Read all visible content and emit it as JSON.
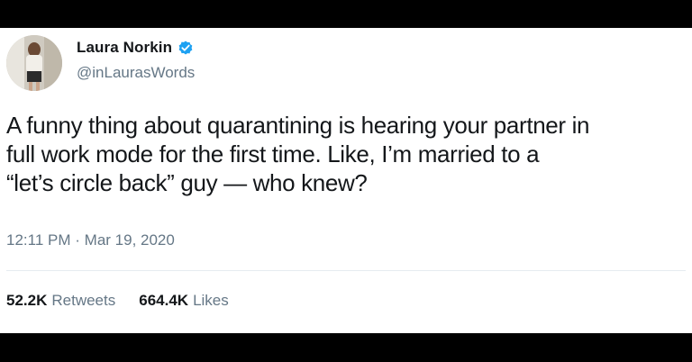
{
  "user": {
    "display_name": "Laura Norkin",
    "handle": "@inLaurasWords",
    "avatar_icon": "profile-photo",
    "verified_icon": "verified-badge-icon"
  },
  "tweet": {
    "lines": [
      "A funny thing about quarantining is hearing your partner in",
      "full work mode for the first time. Like, I’m married to a",
      "“let’s circle back” guy — who knew?"
    ],
    "time": "12:11 PM",
    "separator": "·",
    "date": "Mar 19, 2020"
  },
  "stats": {
    "retweets_count": "52.2K",
    "retweets_label": "Retweets",
    "likes_count": "664.4K",
    "likes_label": "Likes"
  },
  "colors": {
    "verified_blue": "#1da1f2",
    "text_primary": "#14171a",
    "text_secondary": "#657786",
    "frame": "#000000"
  }
}
